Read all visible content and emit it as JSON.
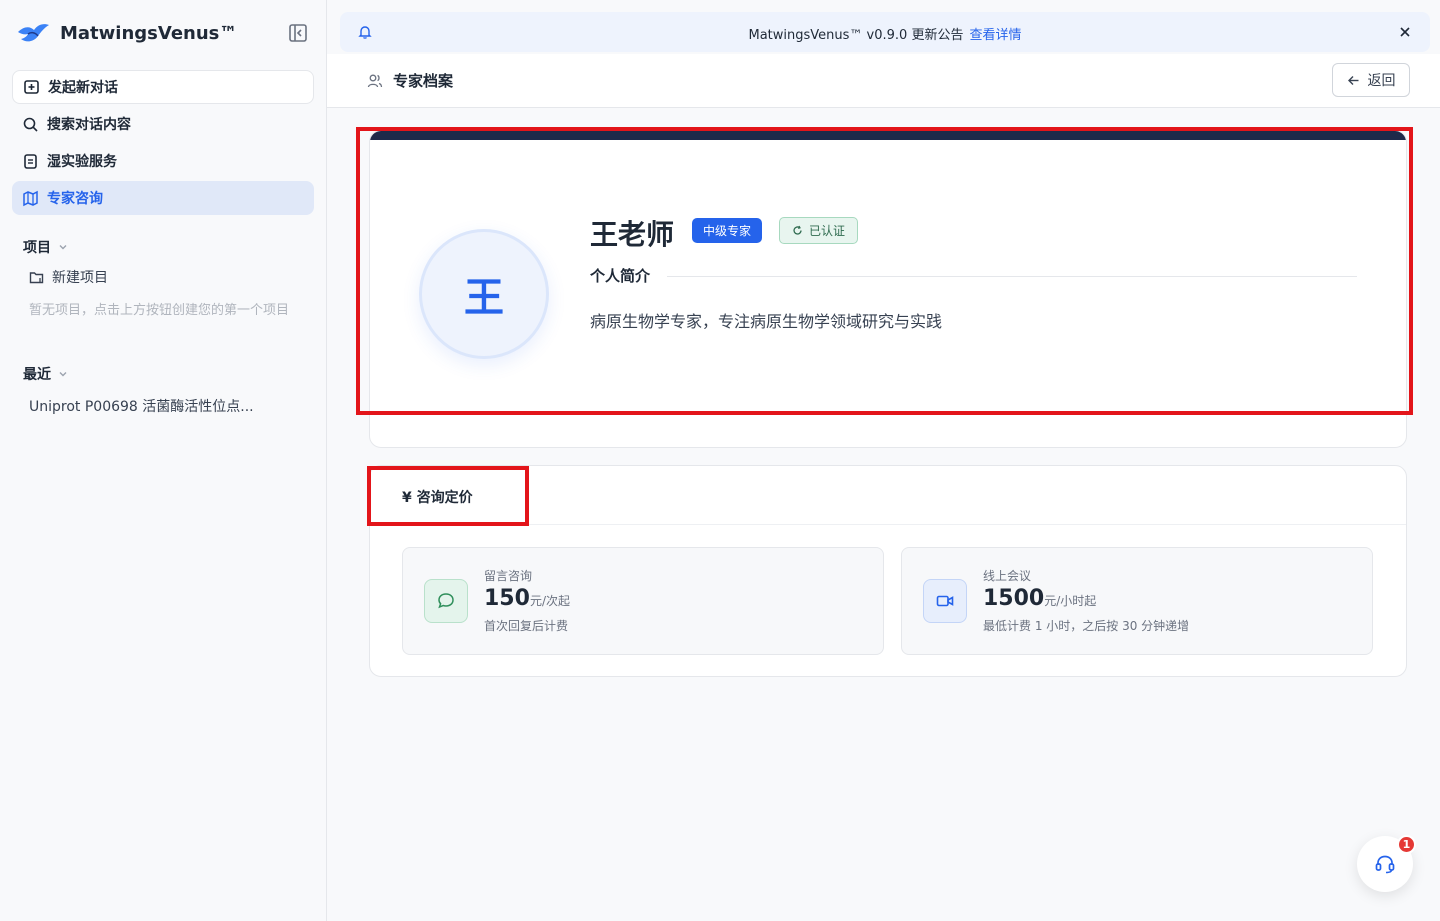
{
  "app": {
    "name": "MatwingsVenus™"
  },
  "sidebar": {
    "items": [
      {
        "label": "发起新对话",
        "icon": "new-chat-icon"
      },
      {
        "label": "搜索对话内容",
        "icon": "search-icon"
      },
      {
        "label": "湿实验服务",
        "icon": "document-icon"
      },
      {
        "label": "专家咨询",
        "icon": "map-icon",
        "active": true
      }
    ],
    "projects": {
      "title": "项目",
      "new_label": "新建项目",
      "empty_hint": "暂无项目，点击上方按钮创建您的第一个项目"
    },
    "recent": {
      "title": "最近",
      "items": [
        "Uniprot P00698 活菌酶活性位点..."
      ]
    }
  },
  "banner": {
    "text": "MatwingsVenus™ v0.9.0 更新公告",
    "link": "查看详情"
  },
  "header": {
    "title": "专家档案",
    "back_label": "返回"
  },
  "profile": {
    "avatar_char": "王",
    "name": "王老师",
    "level_badge": "中级专家",
    "cert_badge": "已认证",
    "intro_title": "个人简介",
    "intro_text": "病原生物学专家，专注病原生物学领域研究与实践"
  },
  "pricing": {
    "title": "¥ 咨询定价",
    "options": [
      {
        "label": "留言咨询",
        "price": "150",
        "unit": "元/次起",
        "note": "首次回复后计费",
        "icon": "chat-bubble-icon"
      },
      {
        "label": "线上会议",
        "price": "1500",
        "unit": "元/小时起",
        "note": "最低计费 1 小时，之后按 30 分钟递增",
        "icon": "video-icon"
      }
    ]
  },
  "support": {
    "badge": "1"
  },
  "colors": {
    "accent": "#2563eb",
    "highlight": "#e3151a",
    "topbar": "#1e2a4a"
  }
}
